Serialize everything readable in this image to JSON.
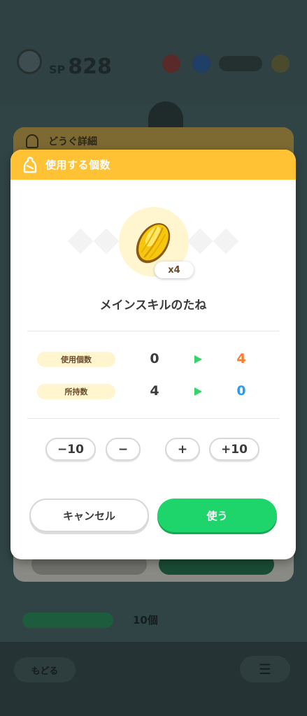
{
  "background": {
    "sp_label": "SP",
    "sp_value": "828",
    "detail_modal_title": "どうぐ詳細",
    "held_label": "",
    "held_value": "10個",
    "back_label": "もどる",
    "menu_glyph": "☰"
  },
  "modal": {
    "title": "使用する個数",
    "item_name": "メインスキルのたね",
    "quantity_badge": "x4",
    "rows": [
      {
        "label": "使用個数",
        "before": "0",
        "after": "4",
        "after_color": "#ff7a2e"
      },
      {
        "label": "所持数",
        "before": "4",
        "after": "0",
        "after_color": "#2f9bf0"
      }
    ],
    "steppers": {
      "minus10": "−10",
      "minus1": "−",
      "plus1": "+",
      "plus10": "+10"
    },
    "cancel_label": "キャンセル",
    "use_label": "使う"
  },
  "colors": {
    "header": "#ffc234",
    "use_button": "#1ed56b",
    "label_pill": "#fff6cf"
  }
}
